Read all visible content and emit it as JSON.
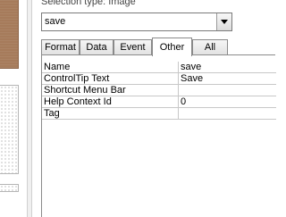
{
  "selection_type_label": "Selection type:  Image",
  "object_selector": {
    "value": "save"
  },
  "tabs": [
    {
      "label": "Format",
      "active": false
    },
    {
      "label": "Data",
      "active": false
    },
    {
      "label": "Event",
      "active": false
    },
    {
      "label": "Other",
      "active": true
    },
    {
      "label": "All",
      "active": false
    }
  ],
  "properties": [
    {
      "name": "Name",
      "value": "save"
    },
    {
      "name": "ControlTip Text",
      "value": "Save"
    },
    {
      "name": "Shortcut Menu Bar",
      "value": ""
    },
    {
      "name": "Help Context Id",
      "value": "0"
    },
    {
      "name": "Tag",
      "value": ""
    }
  ],
  "colors": {
    "design_surface_brown": "#a67b5b",
    "grid_lines": "#c8c8c8",
    "tab_border": "#8a8a8a"
  },
  "icons": {
    "combo_dropdown": "chevron-down-icon"
  }
}
